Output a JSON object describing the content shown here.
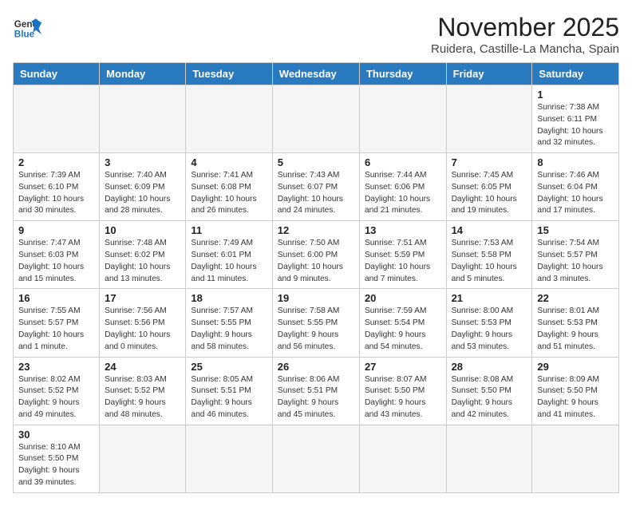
{
  "header": {
    "logo_general": "General",
    "logo_blue": "Blue",
    "month_title": "November 2025",
    "location": "Ruidera, Castille-La Mancha, Spain"
  },
  "days_of_week": [
    "Sunday",
    "Monday",
    "Tuesday",
    "Wednesday",
    "Thursday",
    "Friday",
    "Saturday"
  ],
  "weeks": [
    [
      {
        "day": "",
        "info": ""
      },
      {
        "day": "",
        "info": ""
      },
      {
        "day": "",
        "info": ""
      },
      {
        "day": "",
        "info": ""
      },
      {
        "day": "",
        "info": ""
      },
      {
        "day": "",
        "info": ""
      },
      {
        "day": "1",
        "info": "Sunrise: 7:38 AM\nSunset: 6:11 PM\nDaylight: 10 hours and 32 minutes."
      }
    ],
    [
      {
        "day": "2",
        "info": "Sunrise: 7:39 AM\nSunset: 6:10 PM\nDaylight: 10 hours and 30 minutes."
      },
      {
        "day": "3",
        "info": "Sunrise: 7:40 AM\nSunset: 6:09 PM\nDaylight: 10 hours and 28 minutes."
      },
      {
        "day": "4",
        "info": "Sunrise: 7:41 AM\nSunset: 6:08 PM\nDaylight: 10 hours and 26 minutes."
      },
      {
        "day": "5",
        "info": "Sunrise: 7:43 AM\nSunset: 6:07 PM\nDaylight: 10 hours and 24 minutes."
      },
      {
        "day": "6",
        "info": "Sunrise: 7:44 AM\nSunset: 6:06 PM\nDaylight: 10 hours and 21 minutes."
      },
      {
        "day": "7",
        "info": "Sunrise: 7:45 AM\nSunset: 6:05 PM\nDaylight: 10 hours and 19 minutes."
      },
      {
        "day": "8",
        "info": "Sunrise: 7:46 AM\nSunset: 6:04 PM\nDaylight: 10 hours and 17 minutes."
      }
    ],
    [
      {
        "day": "9",
        "info": "Sunrise: 7:47 AM\nSunset: 6:03 PM\nDaylight: 10 hours and 15 minutes."
      },
      {
        "day": "10",
        "info": "Sunrise: 7:48 AM\nSunset: 6:02 PM\nDaylight: 10 hours and 13 minutes."
      },
      {
        "day": "11",
        "info": "Sunrise: 7:49 AM\nSunset: 6:01 PM\nDaylight: 10 hours and 11 minutes."
      },
      {
        "day": "12",
        "info": "Sunrise: 7:50 AM\nSunset: 6:00 PM\nDaylight: 10 hours and 9 minutes."
      },
      {
        "day": "13",
        "info": "Sunrise: 7:51 AM\nSunset: 5:59 PM\nDaylight: 10 hours and 7 minutes."
      },
      {
        "day": "14",
        "info": "Sunrise: 7:53 AM\nSunset: 5:58 PM\nDaylight: 10 hours and 5 minutes."
      },
      {
        "day": "15",
        "info": "Sunrise: 7:54 AM\nSunset: 5:57 PM\nDaylight: 10 hours and 3 minutes."
      }
    ],
    [
      {
        "day": "16",
        "info": "Sunrise: 7:55 AM\nSunset: 5:57 PM\nDaylight: 10 hours and 1 minute."
      },
      {
        "day": "17",
        "info": "Sunrise: 7:56 AM\nSunset: 5:56 PM\nDaylight: 10 hours and 0 minutes."
      },
      {
        "day": "18",
        "info": "Sunrise: 7:57 AM\nSunset: 5:55 PM\nDaylight: 9 hours and 58 minutes."
      },
      {
        "day": "19",
        "info": "Sunrise: 7:58 AM\nSunset: 5:55 PM\nDaylight: 9 hours and 56 minutes."
      },
      {
        "day": "20",
        "info": "Sunrise: 7:59 AM\nSunset: 5:54 PM\nDaylight: 9 hours and 54 minutes."
      },
      {
        "day": "21",
        "info": "Sunrise: 8:00 AM\nSunset: 5:53 PM\nDaylight: 9 hours and 53 minutes."
      },
      {
        "day": "22",
        "info": "Sunrise: 8:01 AM\nSunset: 5:53 PM\nDaylight: 9 hours and 51 minutes."
      }
    ],
    [
      {
        "day": "23",
        "info": "Sunrise: 8:02 AM\nSunset: 5:52 PM\nDaylight: 9 hours and 49 minutes."
      },
      {
        "day": "24",
        "info": "Sunrise: 8:03 AM\nSunset: 5:52 PM\nDaylight: 9 hours and 48 minutes."
      },
      {
        "day": "25",
        "info": "Sunrise: 8:05 AM\nSunset: 5:51 PM\nDaylight: 9 hours and 46 minutes."
      },
      {
        "day": "26",
        "info": "Sunrise: 8:06 AM\nSunset: 5:51 PM\nDaylight: 9 hours and 45 minutes."
      },
      {
        "day": "27",
        "info": "Sunrise: 8:07 AM\nSunset: 5:50 PM\nDaylight: 9 hours and 43 minutes."
      },
      {
        "day": "28",
        "info": "Sunrise: 8:08 AM\nSunset: 5:50 PM\nDaylight: 9 hours and 42 minutes."
      },
      {
        "day": "29",
        "info": "Sunrise: 8:09 AM\nSunset: 5:50 PM\nDaylight: 9 hours and 41 minutes."
      }
    ],
    [
      {
        "day": "30",
        "info": "Sunrise: 8:10 AM\nSunset: 5:50 PM\nDaylight: 9 hours and 39 minutes."
      },
      {
        "day": "",
        "info": ""
      },
      {
        "day": "",
        "info": ""
      },
      {
        "day": "",
        "info": ""
      },
      {
        "day": "",
        "info": ""
      },
      {
        "day": "",
        "info": ""
      },
      {
        "day": "",
        "info": ""
      }
    ]
  ]
}
